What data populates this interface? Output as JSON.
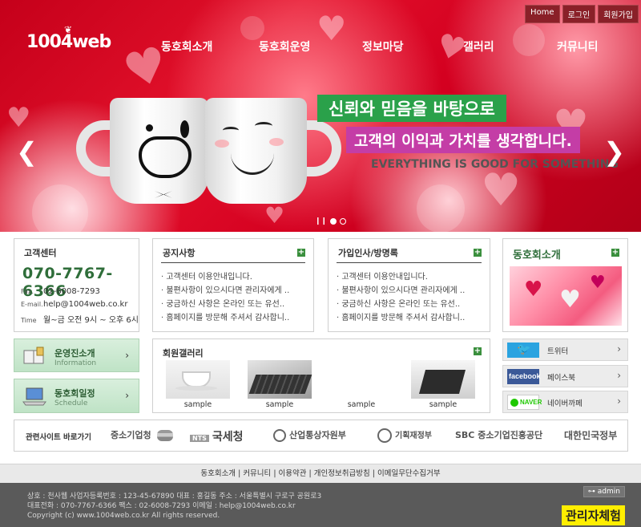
{
  "header": {
    "top_links": [
      "Home",
      "로그인",
      "회원가입"
    ],
    "logo": "1004web",
    "nav": [
      "동호회소개",
      "동호회운영",
      "정보마당",
      "갤러리",
      "커뮤니티"
    ]
  },
  "hero": {
    "slogan_main": "신뢰와 믿음을 바탕으로",
    "slogan_sub": "고객의 이익과 가치를 생각합니다.",
    "slogan_en": "EVERYTHING IS GOOD FOR SOMETHING",
    "prev_icon": "chevron-left-icon",
    "next_icon": "chevron-right-icon",
    "slide_count": 2,
    "active_slide": 1
  },
  "customer_center": {
    "title": "고객센터",
    "phone": "070-7767-6366",
    "fax_label": "Fax.",
    "fax": "02-6008-7293",
    "email_label": "E-mail.",
    "email": "help@1004web.co.kr",
    "time_label": "Time",
    "time": "월~금 오전 9시 ~ 오후 6시"
  },
  "notice": {
    "title": "공지사항",
    "items": [
      "· 고객센터 이용안내입니다.",
      "· 불편사항이 있으시다면 관리자에게 ..",
      "· 궁금하신 사항은 온라인 또는 유선..",
      "· 홈페이지를 방문해 주셔서 감사합니.."
    ]
  },
  "guestbook": {
    "title": "가입인사/방명록",
    "items": [
      "· 고객센터 이용안내입니다.",
      "· 불편사항이 있으시다면 관리자에게 ..",
      "· 궁금하신 사항은 온라인 또는 유선..",
      "· 홈페이지를 방문해 주셔서 감사합니.."
    ]
  },
  "club_intro": {
    "title": "동호회소개"
  },
  "quick": [
    {
      "title": "운영진소개",
      "sub": "Information",
      "icon": "book-icon"
    },
    {
      "title": "동호회일정",
      "sub": "Schedule",
      "icon": "laptop-icon"
    }
  ],
  "gallery": {
    "title": "회원갤러리",
    "captions": [
      "sample",
      "sample",
      "sample",
      "sample"
    ]
  },
  "sns": [
    {
      "name": "트위터",
      "icon": "twitter-icon",
      "color": "#2aa3e0"
    },
    {
      "name": "페이스북",
      "icon": "facebook-icon",
      "color": "#3b5998"
    },
    {
      "name": "네이버까페",
      "icon": "naver-icon",
      "color": "#1ec800"
    }
  ],
  "related": {
    "title": "관련사이트 바로가기",
    "sites": [
      "중소기업청",
      "국세청",
      "산업통상자원부",
      "기획재정부",
      "SBC 중소기업진흥공단",
      "대한민국정부"
    ]
  },
  "footer": {
    "links": [
      "동호회소개",
      "커뮤니티",
      "이용약관",
      "개인정보취급방침",
      "이메일무단수집거부"
    ],
    "line1": "상호 : 천사웹  사업자등록번호 : 123-45-67890  대표 : 홍길동  주소 : 서울특별시 구로구 공원로3",
    "line2": "대표전화 : 070-7767-6366  팩스 : 02-6008-7293  이메일 : help@1004web.co.kr",
    "copyright": "Copyright (c) www.1004web.co.kr All rights reserved.",
    "admin_label": "admin",
    "admin_demo": "관리자체험"
  },
  "colors": {
    "accent_green": "#2aa14a",
    "accent_magenta": "#c43da6",
    "hero_red": "#d40020",
    "footer_bg": "#5a5a5a",
    "admin_yellow": "#ffee00"
  }
}
